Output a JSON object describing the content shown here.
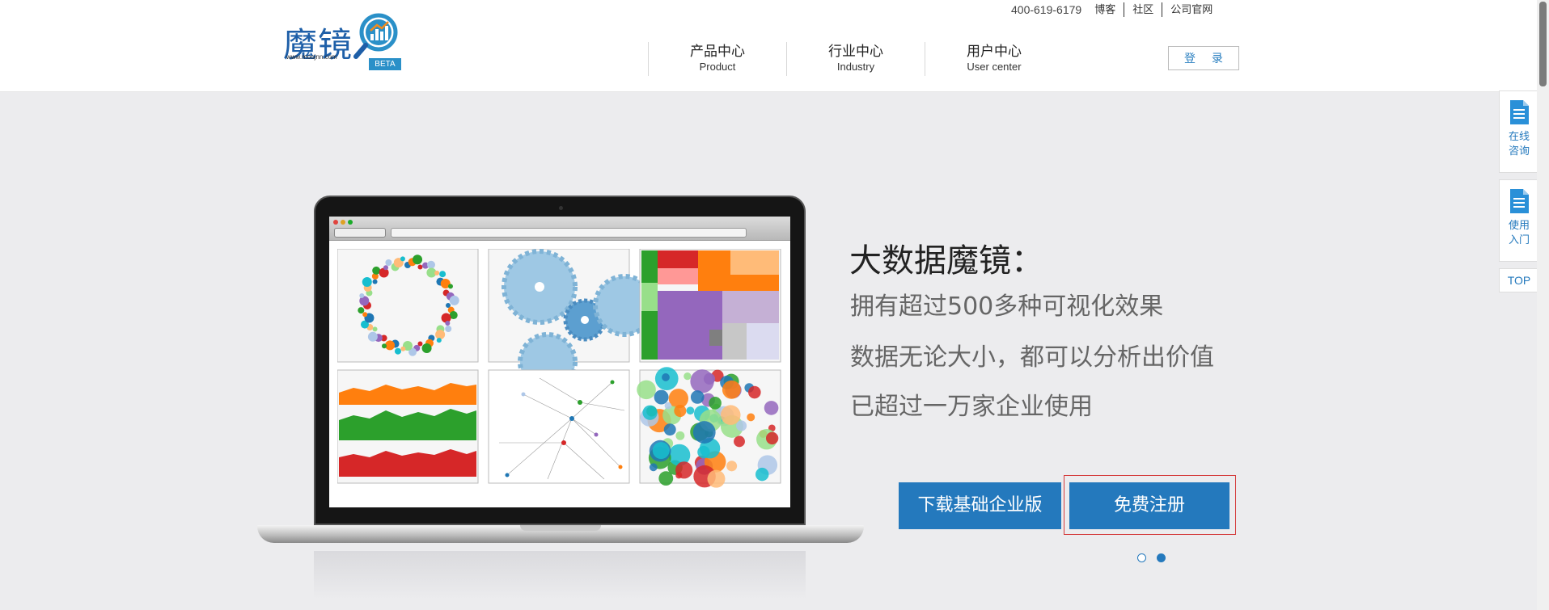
{
  "header": {
    "logo": {
      "text": "魔镜",
      "url": "www.moojnn.com",
      "badge": "BETA"
    },
    "phone": "400-619-6179",
    "top_links": [
      "博客",
      "社区",
      "公司官网"
    ],
    "nav": [
      {
        "zh": "产品中心",
        "en": "Product"
      },
      {
        "zh": "行业中心",
        "en": "Industry"
      },
      {
        "zh": "用户中心",
        "en": "User center"
      }
    ],
    "login_label": "登 录"
  },
  "banner": {
    "headline": "大数据魔镜：",
    "lines": [
      "拥有超过500多种可视化效果",
      "数据无论大小，都可以分析出价值",
      "已超过一万家企业使用"
    ],
    "download_label": "下载基础企业版",
    "register_label": "免费注册",
    "slider": {
      "count": 2,
      "active_index": 2
    }
  },
  "side_widgets": {
    "consult": "在线\n咨询",
    "guide": "使用\n入门",
    "top": "TOP"
  },
  "colors": {
    "accent": "#2479bd",
    "logo_blue": "#1e5fa8",
    "banner_bg": "#ececee"
  }
}
